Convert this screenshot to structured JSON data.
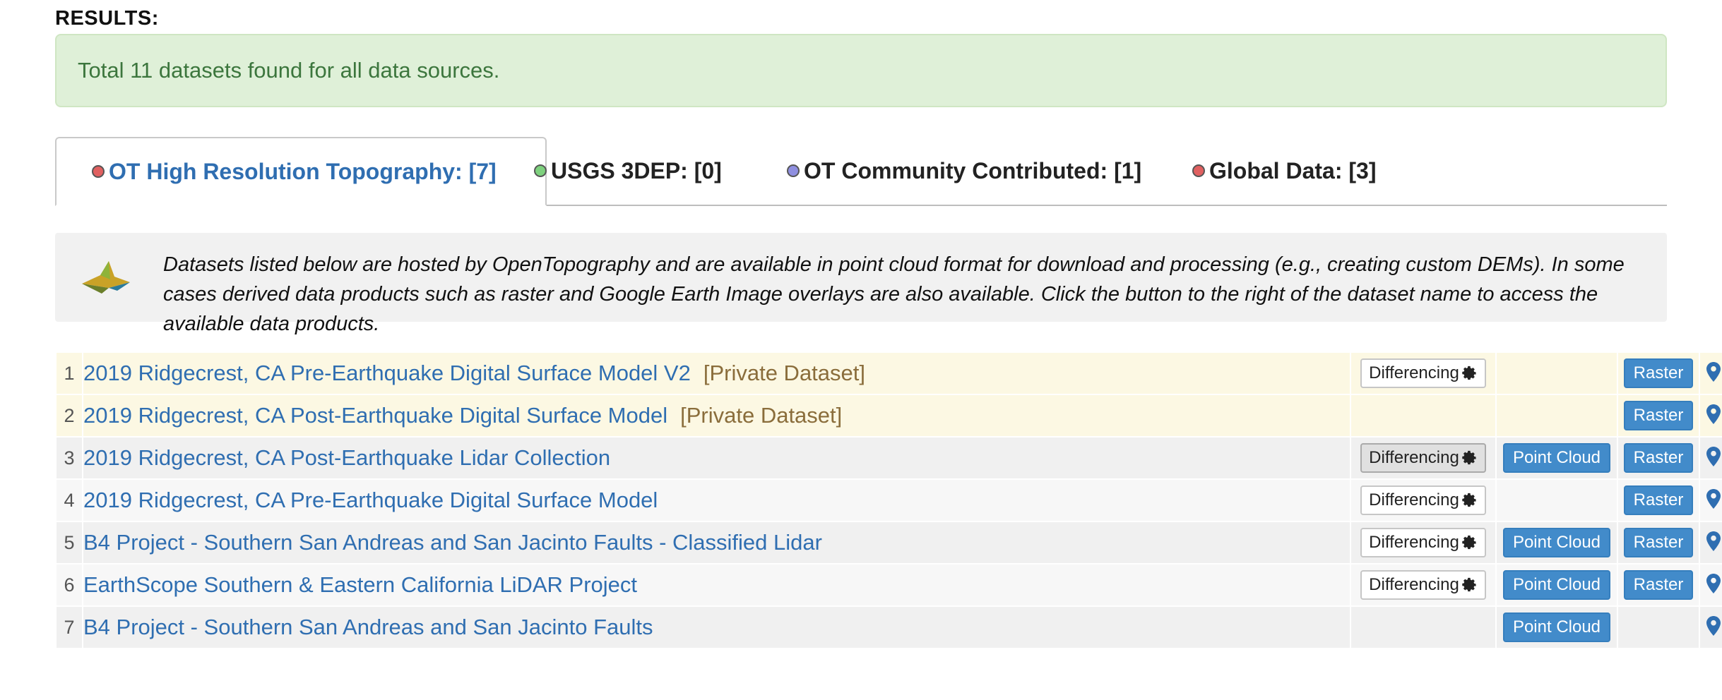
{
  "results_heading": "RESULTS:",
  "alert_text": "Total 11 datasets found for all data sources.",
  "tabs": [
    {
      "label": "OT High Resolution Topography: [7]",
      "dot_color": "#e06060",
      "active": true
    },
    {
      "label": "USGS 3DEP: [0]",
      "dot_color": "#7ed17e",
      "active": false
    },
    {
      "label": "OT Community Contributed: [1]",
      "dot_color": "#8f8fe0",
      "active": false
    },
    {
      "label": "Global Data: [3]",
      "dot_color": "#e06060",
      "active": false
    }
  ],
  "info_text": "Datasets listed below are hosted by OpenTopography and are available in point cloud format for download and processing (e.g., creating custom DEMs). In some cases derived data products such as raster and Google Earth Image overlays are also available. Click the button to the right of the dataset name to access the available data products.",
  "buttons": {
    "differencing": "Differencing",
    "point_cloud": "Point Cloud",
    "raster": "Raster"
  },
  "rows": [
    {
      "num": "1",
      "name": "2019 Ridgecrest, CA Pre-Earthquake Digital Surface Model V2",
      "private_tag": "[Private Dataset]",
      "differencing": true,
      "point_cloud": false,
      "raster": true
    },
    {
      "num": "2",
      "name": "2019 Ridgecrest, CA Post-Earthquake Digital Surface Model",
      "private_tag": "[Private Dataset]",
      "differencing": false,
      "point_cloud": false,
      "raster": true
    },
    {
      "num": "3",
      "name": "2019 Ridgecrest, CA Post-Earthquake Lidar Collection",
      "private_tag": "",
      "differencing": true,
      "point_cloud": true,
      "raster": true
    },
    {
      "num": "4",
      "name": "2019 Ridgecrest, CA Pre-Earthquake Digital Surface Model",
      "private_tag": "",
      "differencing": true,
      "point_cloud": false,
      "raster": true
    },
    {
      "num": "5",
      "name": "B4 Project - Southern San Andreas and San Jacinto Faults - Classified Lidar",
      "private_tag": "",
      "differencing": true,
      "point_cloud": true,
      "raster": true
    },
    {
      "num": "6",
      "name": "EarthScope Southern & Eastern California LiDAR Project",
      "private_tag": "",
      "differencing": true,
      "point_cloud": true,
      "raster": true
    },
    {
      "num": "7",
      "name": "B4 Project - Southern San Andreas and San Jacinto Faults",
      "private_tag": "",
      "differencing": false,
      "point_cloud": true,
      "raster": false
    }
  ]
}
